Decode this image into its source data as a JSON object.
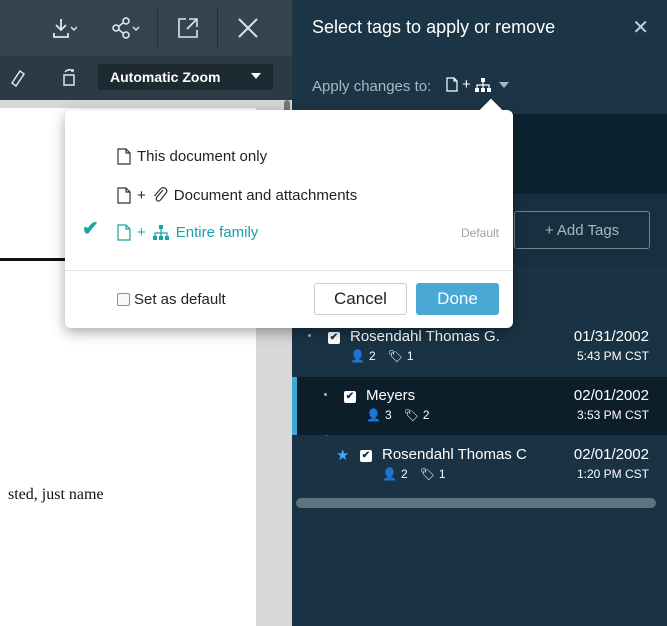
{
  "viewer": {
    "zoom_value": "Automatic Zoom",
    "doc_text": "sted, just name"
  },
  "panel": {
    "title": "Select tags to apply or remove",
    "close_glyph": "✕",
    "apply_label": "Apply changes to:",
    "add_tags_label": "+ Add Tags"
  },
  "popup": {
    "options": [
      {
        "label": "This document only",
        "selected": false
      },
      {
        "label": "Document and attachments",
        "selected": false
      },
      {
        "label": "Entire family",
        "selected": true
      }
    ],
    "default_badge": "Default",
    "set_default_label": "Set as default",
    "cancel_label": "Cancel",
    "done_label": "Done"
  },
  "documents": [
    {
      "name": "Rosendahl Thomas G.",
      "people": "2",
      "tags": "1",
      "date": "01/31/2002",
      "time": "5:43 PM CST",
      "starred": false,
      "checked": true
    },
    {
      "name": "Meyers",
      "people": "3",
      "tags": "2",
      "date": "02/01/2002",
      "time": "3:53 PM CST",
      "starred": false,
      "checked": true
    },
    {
      "name": "Rosendahl Thomas C",
      "people": "2",
      "tags": "1",
      "date": "02/01/2002",
      "time": "1:20 PM CST",
      "starred": true,
      "checked": true
    }
  ],
  "colors": {
    "accent_teal": "#1aa3a3",
    "done_blue": "#4aa9d4",
    "panel_dark": "#0f2a3a",
    "selected_row_marker": "#3fa7d6"
  }
}
